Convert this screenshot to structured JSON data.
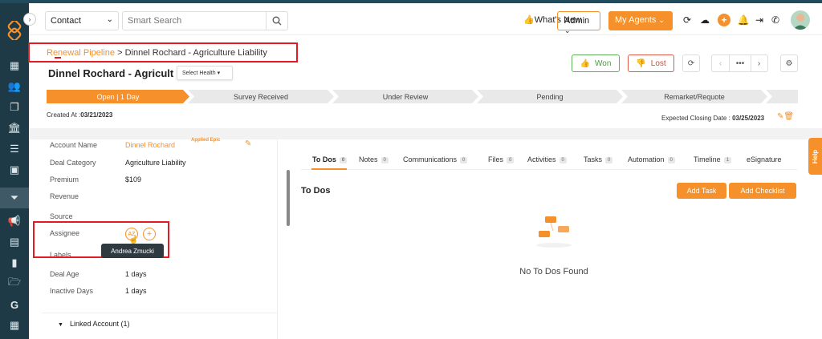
{
  "header": {
    "context_select": "Contact",
    "search_placeholder": "Smart Search",
    "whats_new": "What's New",
    "admin": "Admin",
    "my_agents": "My Agents"
  },
  "breadcrumb": {
    "parent": "Renewal Pipeline",
    "separator": ">",
    "current": "Dinnel Rochard - Agriculture Liability"
  },
  "deal": {
    "title": "Dinnel Rochard - Agricult",
    "health_label": "Select Health",
    "won_label": "Won",
    "lost_label": "Lost"
  },
  "pipeline": {
    "stages": [
      {
        "label": "Open | 1 Day",
        "active": true
      },
      {
        "label": "Survey Received",
        "active": false
      },
      {
        "label": "Under Review",
        "active": false
      },
      {
        "label": "Pending",
        "active": false
      },
      {
        "label": "Remarket/Requote",
        "active": false
      }
    ]
  },
  "dates": {
    "created_label": "Created At :",
    "created_value": "03/21/2023",
    "closing_label": "Expected Closing Date :",
    "closing_value": "03/25/2023"
  },
  "details": {
    "account_name_label": "Account Name",
    "account_name_value": "Dinnel Rochard",
    "applied_logo": "Applied Epic",
    "deal_category_label": "Deal Category",
    "deal_category_value": "Agriculture Liability",
    "premium_label": "Premium",
    "premium_value": "$109",
    "revenue_label": "Revenue",
    "source_label": "Source",
    "assignee_label": "Assignee",
    "assignee_initials": "AZ",
    "labels_label": "Labels",
    "deal_age_label": "Deal Age",
    "deal_age_value": "1 days",
    "inactive_days_label": "Inactive Days",
    "inactive_days_value": "1 days",
    "tooltip": "Andrea Zmucki",
    "linked_account": "Linked Account (1)"
  },
  "tabs": [
    {
      "label": "To Dos",
      "count": "0"
    },
    {
      "label": "Notes",
      "count": "0"
    },
    {
      "label": "Communications",
      "count": "0"
    },
    {
      "label": "Files",
      "count": "0"
    },
    {
      "label": "Activities",
      "count": "0"
    },
    {
      "label": "Tasks",
      "count": "0"
    },
    {
      "label": "Automation",
      "count": "0"
    },
    {
      "label": "Timeline",
      "count": "1"
    },
    {
      "label": "eSignature",
      "count": ""
    }
  ],
  "todos": {
    "title": "To Dos",
    "add_task": "Add Task",
    "add_checklist": "Add Checklist",
    "empty_text": "No To Dos Found"
  },
  "help": "Help",
  "colors": {
    "accent": "#f5902a",
    "sidebar": "#1e3a46",
    "won": "#4a9a44",
    "lost": "#d64a3a",
    "highlight_box": "#e21b23"
  }
}
